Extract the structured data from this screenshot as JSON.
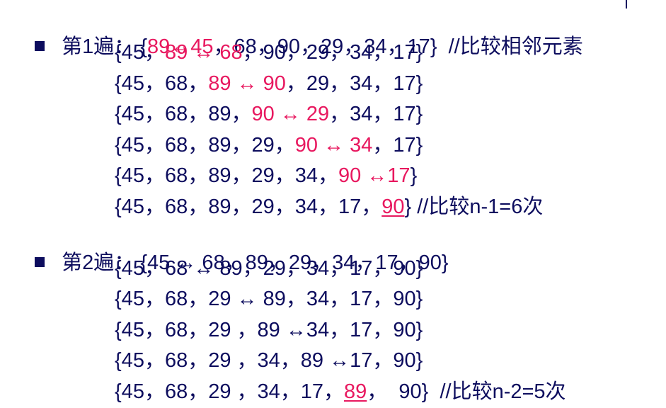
{
  "colors": {
    "text": "#0d0d5e",
    "highlight": "#e8185f"
  },
  "passes": [
    {
      "label": "第1遍：",
      "lines": [
        [
          {
            "t": "{",
            "hl": false
          },
          {
            "t": "89↔45",
            "hl": true
          },
          {
            "t": "，68，90，29，34，17}  //比较相邻元素",
            "hl": false
          }
        ],
        [
          {
            "t": "{45，",
            "hl": false
          },
          {
            "t": "89 ↔ 68",
            "hl": true
          },
          {
            "t": "，90，29，34，17}",
            "hl": false
          }
        ],
        [
          {
            "t": "{45，68，",
            "hl": false
          },
          {
            "t": "89 ↔ 90",
            "hl": true
          },
          {
            "t": "，29，34，17}",
            "hl": false
          }
        ],
        [
          {
            "t": "{45，68，89，",
            "hl": false
          },
          {
            "t": "90 ↔ 29",
            "hl": true
          },
          {
            "t": "，34，17}",
            "hl": false
          }
        ],
        [
          {
            "t": "{45，68，89，29，",
            "hl": false
          },
          {
            "t": "90 ↔ 34",
            "hl": true
          },
          {
            "t": "，17}",
            "hl": false
          }
        ],
        [
          {
            "t": "{45，68，89，29，34，",
            "hl": false
          },
          {
            "t": "90 ↔17",
            "hl": true
          },
          {
            "t": "}",
            "hl": false
          }
        ],
        [
          {
            "t": "{45，68，89，29，34，17，",
            "hl": false
          },
          {
            "t": "90",
            "hl": true,
            "ul": true
          },
          {
            "t": "} //比较n-1=6次",
            "hl": false
          }
        ]
      ]
    },
    {
      "label": "第2遍：",
      "lines": [
        [
          {
            "t": "{45 ↔ 68，89，29，34，17，90}",
            "hl": false
          }
        ],
        [
          {
            "t": "{45，68 ↔ 89，29，34，17，90}",
            "hl": false
          }
        ],
        [
          {
            "t": "{45，68，29 ↔ 89，34，17，90}",
            "hl": false
          }
        ],
        [
          {
            "t": "{45，68，29 ，89 ↔34，17，90}",
            "hl": false
          }
        ],
        [
          {
            "t": "{45，68，29 ，34，89 ↔17，90}",
            "hl": false
          }
        ],
        [
          {
            "t": "{45，68，29 ，34，17，",
            "hl": false
          },
          {
            "t": "89",
            "hl": true,
            "ul": true
          },
          {
            "t": "，  90}  //比较n-2=5次",
            "hl": false
          }
        ]
      ]
    }
  ]
}
